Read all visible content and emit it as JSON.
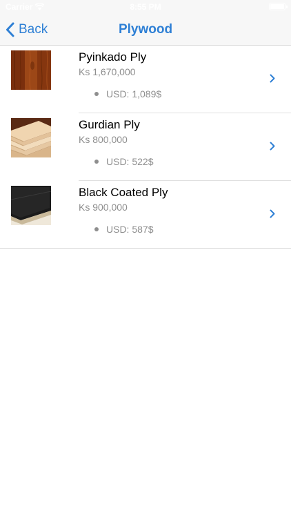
{
  "status_bar": {
    "carrier": "Carrier",
    "time": "8:55 PM"
  },
  "nav": {
    "back_label": "Back",
    "title": "Plywood"
  },
  "colors": {
    "accent": "#2f80d5",
    "secondary_text": "#8e8e8e"
  },
  "products": [
    {
      "name": "Pyinkado Ply",
      "price": "Ks 1,670,000",
      "usd": "USD: 1,089$",
      "image": "wood-grain-thumbnail"
    },
    {
      "name": "Gurdian Ply",
      "price": "Ks 800,000",
      "usd": "USD: 522$",
      "image": "plywood-stack-thumbnail"
    },
    {
      "name": "Black Coated Ply",
      "price": "Ks 900,000",
      "usd": "USD: 587$",
      "image": "black-coated-board-thumbnail"
    }
  ]
}
